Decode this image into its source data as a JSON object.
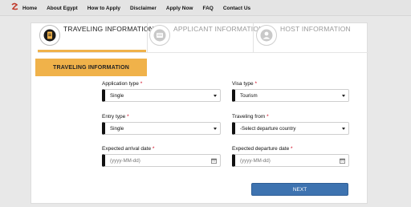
{
  "nav": {
    "items": [
      {
        "label": "Home"
      },
      {
        "label": "About Egypt"
      },
      {
        "label": "How to Apply"
      },
      {
        "label": "Disclaimer"
      },
      {
        "label": "Apply Now"
      },
      {
        "label": "FAQ"
      },
      {
        "label": "Contact Us"
      }
    ]
  },
  "steps": [
    {
      "label": "TRAVELING INFORMATION",
      "icon": "document-icon",
      "active": true
    },
    {
      "label": "APPLICANT INFORMATION",
      "icon": "id-card-icon",
      "active": false
    },
    {
      "label": "HOST INFORMATION",
      "icon": "user-icon",
      "active": false
    }
  ],
  "section": {
    "title": "TRAVELING INFORMATION"
  },
  "form": {
    "application_type": {
      "label": "Application type",
      "value": "Single"
    },
    "visa_type": {
      "label": "Visa type",
      "value": "Tourism"
    },
    "entry_type": {
      "label": "Entry type",
      "value": "Single"
    },
    "traveling_from": {
      "label": "Traveling from",
      "value": "-Select departure country"
    },
    "arrival_date": {
      "label": "Expected arrival date",
      "placeholder": "(yyyy-MM-dd)"
    },
    "departure_date": {
      "label": "Expected departure date",
      "placeholder": "(yyyy-MM-dd)"
    },
    "required_mark": "*"
  },
  "actions": {
    "next_label": "NEXT"
  },
  "colors": {
    "accent": "#f0b24a",
    "primary": "#3e73b0",
    "required": "#d0021b"
  }
}
